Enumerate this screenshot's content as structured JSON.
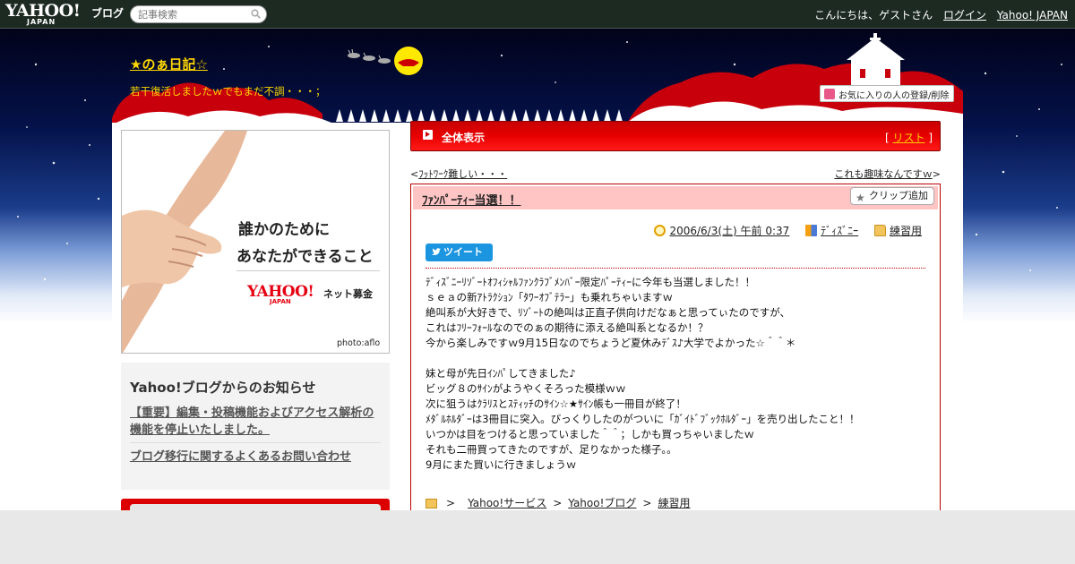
{
  "topbar": {
    "logo": "YAHOO!",
    "logo_sub": "JAPAN",
    "logo_blog": "ブログ",
    "search_placeholder": "記事検索",
    "greeting": "こんにちは、ゲストさん",
    "login": "ログイン",
    "yahoo_japan": "Yahoo! JAPAN"
  },
  "blog": {
    "title": "★のぁ日記☆",
    "subtitle": "若干復活しましたｗでもまだ不調・・・；",
    "favorite_button": "お気に入りの人の登録/削除"
  },
  "ad": {
    "line1": "誰かのために",
    "line2": "あなたができること",
    "logo": "YAHOO!",
    "logo_sub": "JAPAN",
    "service": "ネット募金",
    "credit": "photo:aflo"
  },
  "notice": {
    "title": "Yahoo!ブログからのお知らせ",
    "links": [
      "【重要】編集・投稿機能およびアクセス解析の機能を停止いたしました。",
      "ブログ移行に関するよくあるお問い合わせ"
    ]
  },
  "section": {
    "title": "全体表示",
    "list_label": "リスト"
  },
  "nav": {
    "prev": "ﾌｯﾄﾜｰｸ難しい・・・",
    "next": "これも趣味なんですｗ"
  },
  "article": {
    "title": "ﾌｧﾝﾊﾟｰﾃｨｰ当選！！",
    "clip_button": "クリップ追加",
    "date": "2006/6/3(土) 午前 0:37",
    "tag": "ﾃﾞｨｽﾞﾆｰ",
    "category": "練習用",
    "tweet": "ツイート",
    "body": [
      "ﾃﾞｨｽﾞﾆｰﾘｿﾞｰﾄｵﾌｨｼｬﾙﾌｧﾝｸﾗﾌﾞﾒﾝﾊﾞｰ限定ﾊﾟｰﾃｨｰに今年も当選しました！！",
      "ｓｅａの新ｱﾄﾗｸｼｮﾝ「ﾀﾜｰｵﾌﾞﾃﾗｰ」も乗れちゃいますｗ",
      "絶叫系が大好きで、ﾘｿﾞｰﾄの絶叫は正直子供向けだなぁと思ってぃたのですが、",
      "これはﾌﾘｰﾌｫｰﾙなのでのぁの期待に添える絶叫系となるか！？",
      "今から楽しみですｗ9月15日なのでちょうど夏休みﾃﾞｽ♪大学でよかった☆＾＾＊",
      "",
      "妹と母が先日ｲﾝﾊﾟしてきました♪",
      "ビッグ８のｻｲﾝがようやくそろった模様ｗｗ",
      "次に狙うはｸﾗﾘｽとｽﾃｨｯﾁのｻｲﾝ☆★ｻｲﾝ帳も一冊目が終了！",
      "ﾒﾀﾞﾙﾎﾙﾀﾞｰは3冊目に突入。びっくりしたのがついに「ｶﾞｲﾄﾞﾌﾞｯｸﾎﾙﾀﾞｰ」を売り出したこと！！",
      "いつかは目をつけると思っていました＾＾；しかも買っちゃいましたｗ",
      "それも二冊買ってきたのですが、足りなかった様子。。",
      "9月にまた買いに行きましょうｗ"
    ],
    "breadcrumbs": [
      "Yahoo!サービス",
      "Yahoo!ブログ",
      "練習用"
    ]
  },
  "colors": {
    "accent_red": "#e00000",
    "title_yellow": "#ffd700",
    "twitter_blue": "#1b95e0"
  }
}
